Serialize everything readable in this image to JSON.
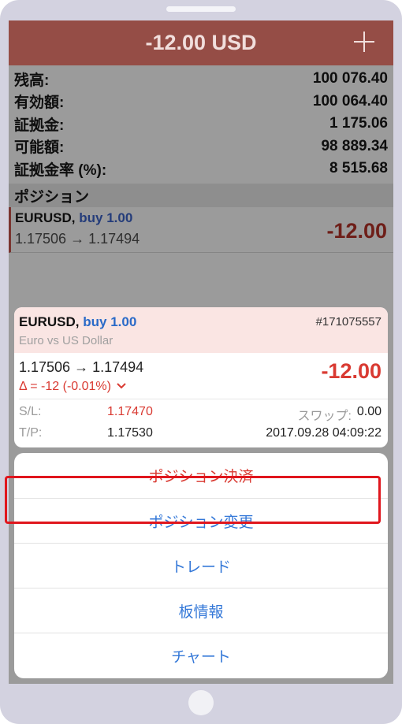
{
  "header": {
    "title": "-12.00 USD"
  },
  "account": [
    {
      "label": "残高:",
      "value": "100 076.40"
    },
    {
      "label": "有効額:",
      "value": "100 064.40"
    },
    {
      "label": "証拠金:",
      "value": "1 175.06"
    },
    {
      "label": "可能額:",
      "value": "98 889.34"
    },
    {
      "label": "証拠金率 (%):",
      "value": "8 515.68"
    }
  ],
  "positions_header": "ポジション",
  "position": {
    "symbol": "EURUSD,",
    "side": "buy 1.00",
    "prices": "1.17506 → 1.17494",
    "profit": "-12.00"
  },
  "card": {
    "symbol": "EURUSD,",
    "side": "buy 1.00",
    "ticket": "#171075557",
    "description": "Euro vs US Dollar",
    "prices": "1.17506 → 1.17494",
    "delta": "Δ = -12 (-0.01%)",
    "profit": "-12.00",
    "sl_label": "S/L:",
    "sl_value": "1.17470",
    "swap_label": "スワップ:",
    "swap_value": "0.00",
    "tp_label": "T/P:",
    "tp_value": "1.17530",
    "time": "2017.09.28 04:09:22"
  },
  "actions": [
    "ポジション決済",
    "ポジション変更",
    "トレード",
    "板情報",
    "チャート"
  ],
  "colors": {
    "header_bg": "#954d46",
    "loss": "#d93a32",
    "link": "#3478d8",
    "highlight_border": "#e0161d"
  }
}
